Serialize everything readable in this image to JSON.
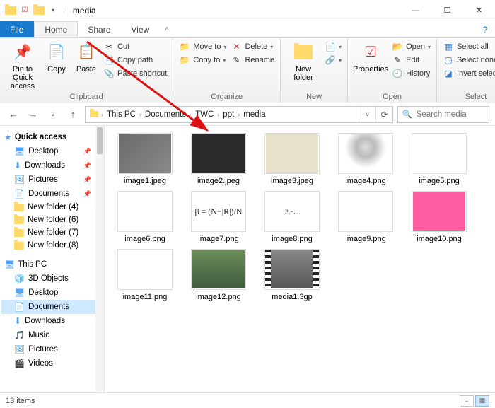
{
  "title": "media",
  "tabs": {
    "file": "File",
    "home": "Home",
    "share": "Share",
    "view": "View"
  },
  "ribbon": {
    "clipboard": {
      "label": "Clipboard",
      "pin": "Pin to Quick access",
      "copy": "Copy",
      "paste": "Paste",
      "cut": "Cut",
      "copypath": "Copy path",
      "pasteshortcut": "Paste shortcut"
    },
    "organize": {
      "label": "Organize",
      "moveto": "Move to",
      "copyto": "Copy to",
      "delete": "Delete",
      "rename": "Rename"
    },
    "new": {
      "label": "New",
      "newfolder": "New folder"
    },
    "open": {
      "label": "Open",
      "properties": "Properties",
      "open": "Open",
      "edit": "Edit",
      "history": "History"
    },
    "select": {
      "label": "Select",
      "selectall": "Select all",
      "selectnone": "Select none",
      "invert": "Invert selection"
    }
  },
  "breadcrumb": [
    "This PC",
    "Documents",
    "TWC",
    "ppt",
    "media"
  ],
  "search_placeholder": "Search media",
  "nav": {
    "quickaccess": "Quick access",
    "qa_items": [
      {
        "label": "Desktop",
        "pinned": true,
        "icon": "desktop"
      },
      {
        "label": "Downloads",
        "pinned": true,
        "icon": "downloads"
      },
      {
        "label": "Pictures",
        "pinned": true,
        "icon": "pictures"
      },
      {
        "label": "Documents",
        "pinned": true,
        "icon": "documents"
      },
      {
        "label": "New folder (4)",
        "pinned": false,
        "icon": "folder"
      },
      {
        "label": "New folder (6)",
        "pinned": false,
        "icon": "folder"
      },
      {
        "label": "New folder (7)",
        "pinned": false,
        "icon": "folder"
      },
      {
        "label": "New folder (8)",
        "pinned": false,
        "icon": "folder"
      }
    ],
    "thispc": "This PC",
    "pc_items": [
      {
        "label": "3D Objects"
      },
      {
        "label": "Desktop"
      },
      {
        "label": "Documents",
        "selected": true
      },
      {
        "label": "Downloads"
      },
      {
        "label": "Music"
      },
      {
        "label": "Pictures"
      },
      {
        "label": "Videos"
      }
    ]
  },
  "files": [
    {
      "name": "image1.jpeg",
      "thumb": "t1"
    },
    {
      "name": "image2.jpeg",
      "thumb": "t2"
    },
    {
      "name": "image3.jpeg",
      "thumb": "t3"
    },
    {
      "name": "image4.png",
      "thumb": "t4"
    },
    {
      "name": "image5.png",
      "thumb": "t5"
    },
    {
      "name": "image6.png",
      "thumb": "t6"
    },
    {
      "name": "image7.png",
      "thumb": "t7",
      "text": "β = (N−|R|)/N"
    },
    {
      "name": "image8.png",
      "thumb": "t8",
      "text": "P₁=…"
    },
    {
      "name": "image9.png",
      "thumb": "t9"
    },
    {
      "name": "image10.png",
      "thumb": "t10"
    },
    {
      "name": "image11.png",
      "thumb": "t11"
    },
    {
      "name": "image12.png",
      "thumb": "t12"
    },
    {
      "name": "media1.3gp",
      "thumb": "t13"
    }
  ],
  "status": "13 items"
}
